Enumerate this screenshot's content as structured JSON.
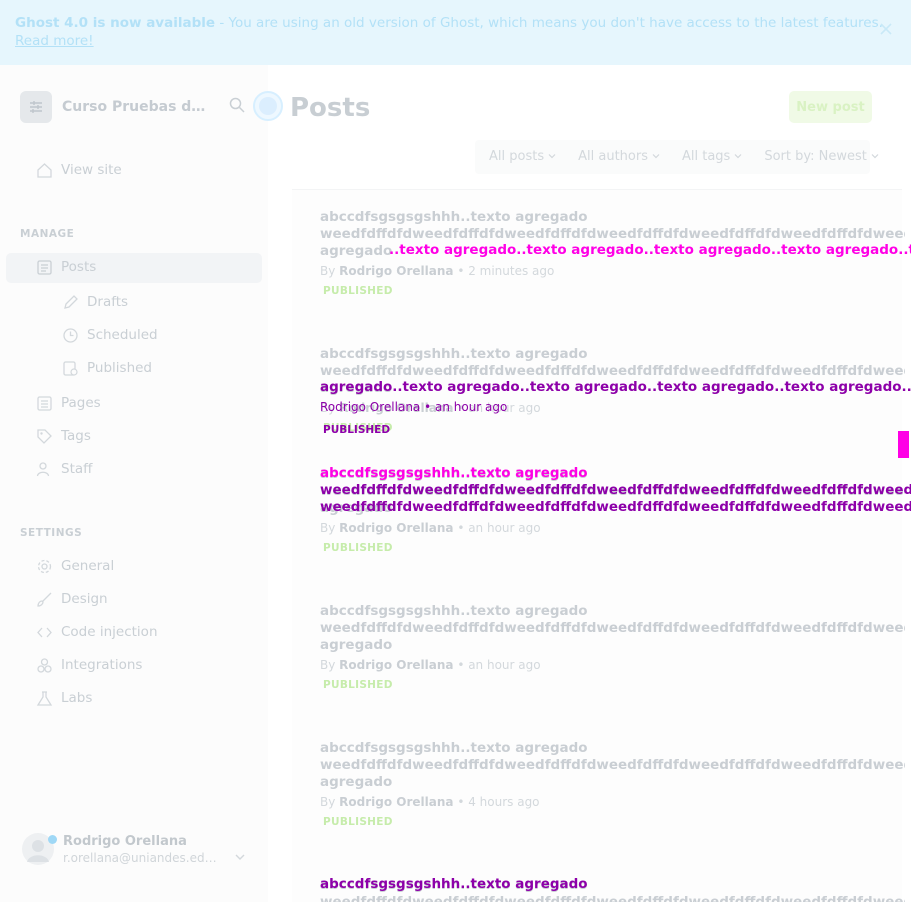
{
  "banner": {
    "headline": "Ghost 4.0 is now available",
    "message": " - You are using an old version of Ghost, which means you don't have access to the latest features.",
    "link": "Read more!"
  },
  "sidebar": {
    "site_name": "Curso Pruebas de Software",
    "view_site": "View site",
    "manage_title": "MANAGE",
    "settings_title": "SETTINGS",
    "items": {
      "posts": "Posts",
      "drafts": "Drafts",
      "scheduled": "Scheduled",
      "published": "Published",
      "pages": "Pages",
      "tags": "Tags",
      "staff": "Staff",
      "general": "General",
      "design": "Design",
      "code_injection": "Code injection",
      "integrations": "Integrations",
      "labs": "Labs"
    },
    "user": {
      "name": "Rodrigo Orellana",
      "email": "r.orellana@uniandes.edu.co"
    }
  },
  "main": {
    "title": "Posts",
    "new_post": "New post",
    "filters": {
      "type": "All posts",
      "authors": "All authors",
      "tags": "All tags",
      "sort": "Sort by: Newest"
    }
  },
  "posts": [
    {
      "title_line1": "abccdfsgsgsgshhh..texto agregado",
      "title_line2": "weedfdffdfdweedfdffdfdweedfdffdfdweedfdffdfdweedfdffdfdweedfdffdfdweedfdffdfdweedfdffdfd",
      "title_line3": "agregado",
      "meta_by": "By ",
      "author": "Rodrigo Orellana",
      "time": " • 2 minutes ago",
      "status": "PUBLISHED"
    },
    {
      "title_line1": "abccdfsgsgsgshhh..texto agregado",
      "title_line2": "weedfdffdfdweedfdffdfdweedfdffdfdweedfdffdfdweedfdffdfdweedfdffdfdweedfdffdfdweedfdffdfd",
      "title_line3": "agregado",
      "meta_by": "By ",
      "author": "Rodrigo Orellana",
      "time": " • an hour ago",
      "status": "PUBLISHED"
    },
    {
      "title_line1": "abccdfsgsgsgshhh..texto agregado",
      "title_line2": "weedfdffdfdweedfdffdfdweedfdffdfdweedfdffdfdweedfdffdfdweedfdffdfdweedfdffdfdweedfdffdfd",
      "title_line3": "agregado",
      "meta_by": "By ",
      "author": "Rodrigo Orellana",
      "time": " • an hour ago",
      "status": "PUBLISHED"
    },
    {
      "title_line1": "abccdfsgsgsgshhh..texto agregado",
      "title_line2": "weedfdffdfdweedfdffdfdweedfdffdfdweedfdffdfdweedfdffdfdweedfdffdfdweedfdffdfdweedfdffdfd",
      "title_line3": "agregado",
      "meta_by": "By ",
      "author": "Rodrigo Orellana",
      "time": " • an hour ago",
      "status": "PUBLISHED"
    },
    {
      "title_line1": "abccdfsgsgsgshhh..texto agregado",
      "title_line2": "weedfdffdfdweedfdffdfdweedfdffdfdweedfdffdfdweedfdffdfdweedfdffdfdweedfdffdfdweedfdffdfd",
      "title_line3": "agregado",
      "meta_by": "By ",
      "author": "Rodrigo Orellana",
      "time": " • 4 hours ago",
      "status": "PUBLISHED"
    },
    {
      "title_line1": "abccdfsgsgsgshhh..texto agregado",
      "title_line2": "weedfdffdfdweedfdffdfdweedfdffdfdweedfdffdfdweedfdffdfdweedfdffdfdweedfdffdfdweedfdffdfd"
    }
  ],
  "overlays": {
    "repeat_line": "..texto agregado..texto agregado..texto agregado..texto agregado..texto agregado",
    "repeat_line_2": "agregado..texto agregado..texto agregado..texto agregado..texto agregado..texto agregado",
    "meta_a": "Rodrigo Orellana • an hour ago",
    "status_a": "PUBLISHED",
    "title_a": "abccdfsgsgsgshhh..texto agregado",
    "title_b": "weedfdffdfdweedfdffdfdweedfdffdfdweedfdffdfdweedfdffdfdweedfdffdfdweedfdffdfd",
    "title_c": "weedfdffdfdweedfdffdfdweedfdffdfdweedfdffdfdweedfdffdfdweedfdffdfdweedfdffdfd",
    "title_d": "abccdfsgsgsgshhh..texto agregado"
  },
  "colors": {
    "accent": "#14b8ff",
    "success": "#30cf43",
    "glitch": "#ff00e6",
    "glitch_alt": "#8d00a9"
  }
}
